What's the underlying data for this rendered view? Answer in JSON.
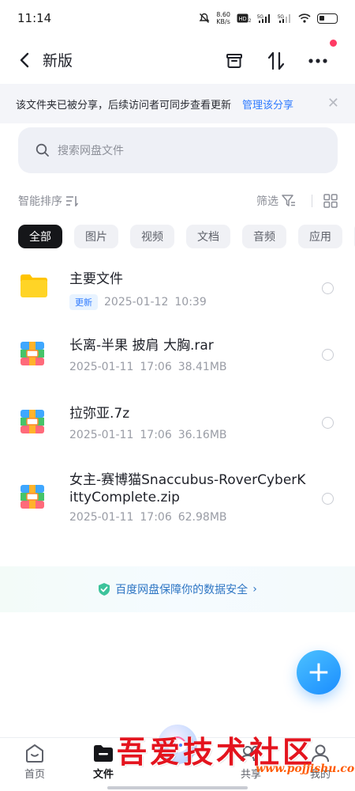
{
  "status_bar": {
    "time": "11:14",
    "net_speed_value": "8.60",
    "net_speed_unit": "KB/s",
    "icons": [
      "mute-icon",
      "hd-icon",
      "signal-5g-1-icon",
      "signal-5g-2-icon",
      "wifi-icon",
      "battery-icon"
    ]
  },
  "header": {
    "title": "新版",
    "icons": [
      "back-icon",
      "archive-icon",
      "transfer-icon",
      "more-icon"
    ]
  },
  "share_banner": {
    "text": "该文件夹已被分享，后续访问者可同步查看更新",
    "link": "管理该分享",
    "close": "✕"
  },
  "search": {
    "placeholder": "搜索网盘文件"
  },
  "toolbar": {
    "sort_label": "智能排序",
    "filter_label": "筛选"
  },
  "chips": [
    {
      "label": "全部",
      "active": true
    },
    {
      "label": "图片",
      "active": false
    },
    {
      "label": "视频",
      "active": false
    },
    {
      "label": "文档",
      "active": false
    },
    {
      "label": "音频",
      "active": false
    },
    {
      "label": "应用",
      "active": false
    }
  ],
  "files": [
    {
      "name": "主要文件",
      "type": "folder",
      "badge": "更新",
      "date": "2025-01-12",
      "time": "10:39",
      "size": ""
    },
    {
      "name": "长离-半果 披肩 大胸.rar",
      "type": "archive",
      "badge": "",
      "date": "2025-01-11",
      "time": "17:06",
      "size": "38.41MB"
    },
    {
      "name": "拉弥亚.7z",
      "type": "archive",
      "badge": "",
      "date": "2025-01-11",
      "time": "17:06",
      "size": "36.16MB"
    },
    {
      "name": "女主-赛博猫Snaccubus-RoverCyberKittyComplete.zip",
      "type": "archive",
      "badge": "",
      "date": "2025-01-11",
      "time": "17:06",
      "size": "62.98MB"
    }
  ],
  "safety_banner": {
    "text": "百度网盘保障你的数据安全",
    "arrow": "›"
  },
  "fab": {
    "label": "+"
  },
  "bottom_nav": {
    "items": [
      {
        "label": "首页",
        "icon": "home-icon",
        "active": false
      },
      {
        "label": "文件",
        "icon": "folder-icon",
        "active": true
      },
      {
        "label": "共享",
        "icon": "share-icon",
        "active": false
      },
      {
        "label": "我的",
        "icon": "profile-icon",
        "active": false
      }
    ]
  },
  "watermark": {
    "text": "吾爱技术社区",
    "url": "www.pojjishu.com"
  },
  "colors": {
    "accent": "#2f7bff",
    "fab": "#1a8dff",
    "active_chip": "#151619",
    "watermark_red": "#e4141e"
  }
}
